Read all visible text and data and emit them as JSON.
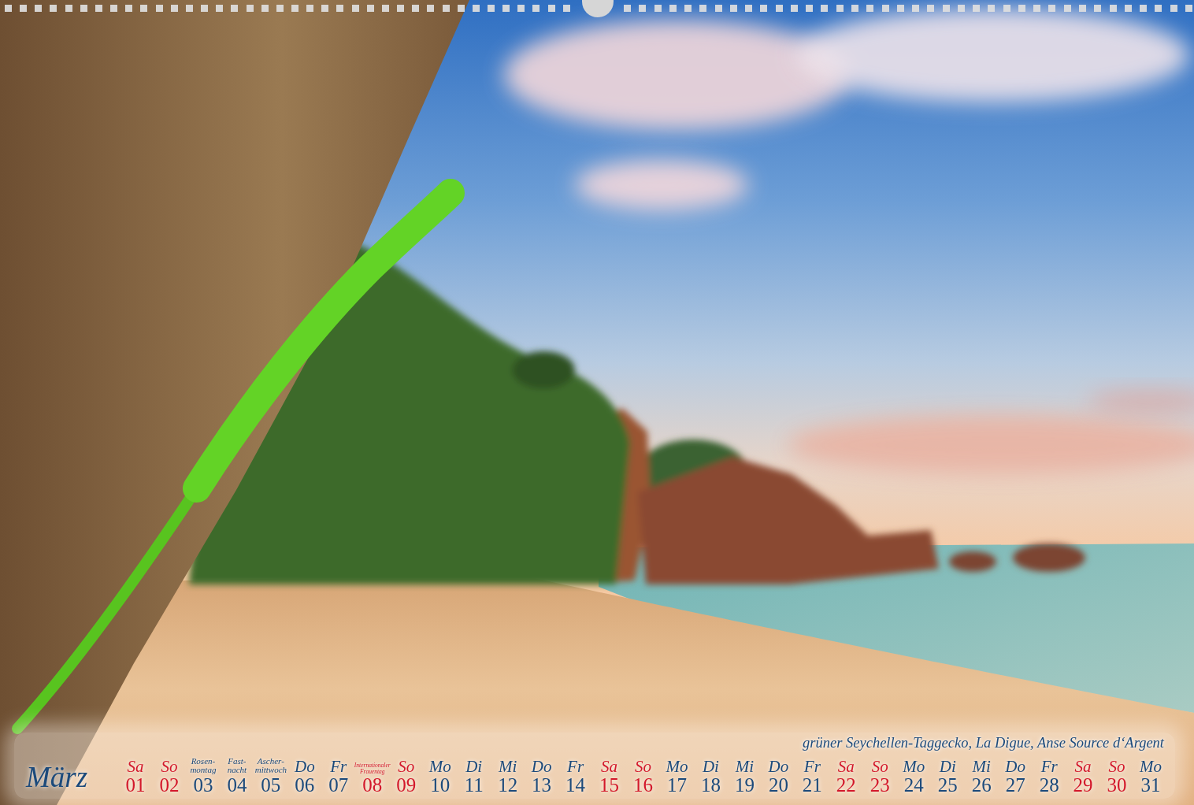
{
  "photo": {
    "caption": "grüner Seychellen-Taggecko, La Digue, Anse Source d‘Argent"
  },
  "calendar": {
    "month": "März",
    "days": [
      {
        "label": "Sa",
        "number": "01",
        "kind": "weekday",
        "color": "#d3182b"
      },
      {
        "label": "So",
        "number": "02",
        "kind": "weekday",
        "color": "#d3182b"
      },
      {
        "label": "Rosen-montag",
        "number": "03",
        "kind": "holiday",
        "color": "#1c4a7b"
      },
      {
        "label": "Fast-nacht",
        "number": "04",
        "kind": "holiday",
        "color": "#1c4a7b"
      },
      {
        "label": "Ascher-mittwoch",
        "number": "05",
        "kind": "holiday",
        "color": "#1c4a7b"
      },
      {
        "label": "Do",
        "number": "06",
        "kind": "weekday",
        "color": "#1c4a7b"
      },
      {
        "label": "Fr",
        "number": "07",
        "kind": "weekday",
        "color": "#1c4a7b"
      },
      {
        "label": "Internationaler Frauentag",
        "number": "08",
        "kind": "holiday",
        "color": "#d3182b"
      },
      {
        "label": "So",
        "number": "09",
        "kind": "weekday",
        "color": "#d3182b"
      },
      {
        "label": "Mo",
        "number": "10",
        "kind": "weekday",
        "color": "#1c4a7b"
      },
      {
        "label": "Di",
        "number": "11",
        "kind": "weekday",
        "color": "#1c4a7b"
      },
      {
        "label": "Mi",
        "number": "12",
        "kind": "weekday",
        "color": "#1c4a7b"
      },
      {
        "label": "Do",
        "number": "13",
        "kind": "weekday",
        "color": "#1c4a7b"
      },
      {
        "label": "Fr",
        "number": "14",
        "kind": "weekday",
        "color": "#1c4a7b"
      },
      {
        "label": "Sa",
        "number": "15",
        "kind": "weekday",
        "color": "#d3182b"
      },
      {
        "label": "So",
        "number": "16",
        "kind": "weekday",
        "color": "#d3182b"
      },
      {
        "label": "Mo",
        "number": "17",
        "kind": "weekday",
        "color": "#1c4a7b"
      },
      {
        "label": "Di",
        "number": "18",
        "kind": "weekday",
        "color": "#1c4a7b"
      },
      {
        "label": "Mi",
        "number": "19",
        "kind": "weekday",
        "color": "#1c4a7b"
      },
      {
        "label": "Do",
        "number": "20",
        "kind": "weekday",
        "color": "#1c4a7b"
      },
      {
        "label": "Fr",
        "number": "21",
        "kind": "weekday",
        "color": "#1c4a7b"
      },
      {
        "label": "Sa",
        "number": "22",
        "kind": "weekday",
        "color": "#d3182b"
      },
      {
        "label": "So",
        "number": "23",
        "kind": "weekday",
        "color": "#d3182b"
      },
      {
        "label": "Mo",
        "number": "24",
        "kind": "weekday",
        "color": "#1c4a7b"
      },
      {
        "label": "Di",
        "number": "25",
        "kind": "weekday",
        "color": "#1c4a7b"
      },
      {
        "label": "Mi",
        "number": "26",
        "kind": "weekday",
        "color": "#1c4a7b"
      },
      {
        "label": "Do",
        "number": "27",
        "kind": "weekday",
        "color": "#1c4a7b"
      },
      {
        "label": "Fr",
        "number": "28",
        "kind": "weekday",
        "color": "#1c4a7b"
      },
      {
        "label": "Sa",
        "number": "29",
        "kind": "weekday",
        "color": "#d3182b"
      },
      {
        "label": "So",
        "number": "30",
        "kind": "weekday",
        "color": "#d3182b"
      },
      {
        "label": "Mo",
        "number": "31",
        "kind": "weekday",
        "color": "#1c4a7b"
      }
    ]
  }
}
